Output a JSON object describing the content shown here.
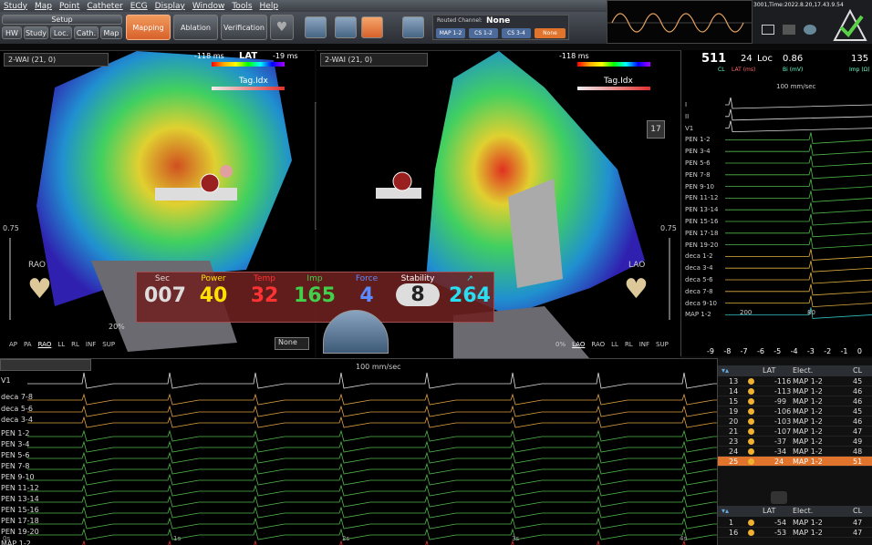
{
  "menu": [
    "Study",
    "Map",
    "Point",
    "Catheter",
    "ECG",
    "Display",
    "Window",
    "Tools",
    "Help"
  ],
  "toolbar": {
    "setup": "Setup",
    "sub": [
      "HW",
      "Study",
      "Loc.",
      "Cath.",
      "Map"
    ],
    "modes": [
      "Mapping",
      "Ablation",
      "Verification"
    ],
    "channel_label": "Routed Channel:",
    "channel_value": "None",
    "channels": [
      "MAP 1-2",
      "CS 1-2",
      "CS 3-4",
      "None"
    ]
  },
  "timestamp": "3001,Time:2022.8.20,17.43.9.54",
  "left_view": {
    "map": "2-WAI (21, 0)",
    "lat_min": "-118 ms",
    "lat_label": "LAT",
    "lat_max": "-19 ms",
    "tag": "Tag.Idx",
    "scale": "0.75",
    "view": "RAO",
    "zoom": "20%",
    "none": "None",
    "views": [
      "AP",
      "PA",
      "RAO",
      "LL",
      "RL",
      "INF",
      "SUP"
    ]
  },
  "right_view": {
    "map": "2-WAI (21, 0)",
    "lat_min": "-118 ms",
    "tag": "Tag.Idx",
    "scale": "0.75",
    "view": "LAO",
    "zoom": "0%",
    "views": [
      "0%",
      "LAO",
      "RAO",
      "LL",
      "RL",
      "INF",
      "SUP"
    ]
  },
  "center_tools": {
    "value": "4",
    "sub": "g"
  },
  "right_tools": {
    "num": "17"
  },
  "metrics": [
    {
      "label": "Sec",
      "value": "007",
      "color": "#ffffff"
    },
    {
      "label": "Power",
      "value": "40",
      "color": "#ffe000"
    },
    {
      "label": "Temp",
      "value": "32",
      "color": "#ff3333"
    },
    {
      "label": "Imp",
      "value": "165",
      "color": "#41d04a"
    },
    {
      "label": "Force",
      "value": "4",
      "color": "#5b8cff"
    },
    {
      "label": "Stability",
      "value": "8",
      "color": "#ffffff"
    },
    {
      "label": "↗",
      "value": "264",
      "color": "#27dff0"
    }
  ],
  "ecg_header": {
    "cl_value": "511",
    "cl_num": "24",
    "loc": "Loc",
    "loc_val": "0.86",
    "imp": "135",
    "cl_label": "CL",
    "lat_label": "LAT (ms)",
    "bi_label": "Bi (mV)",
    "imp_label": "Imp (Ω)",
    "speed": "100 mm/sec"
  },
  "ecg_leads": [
    "I",
    "II",
    "V1",
    "PEN 1-2",
    "PEN 3-4",
    "PEN 5-6",
    "PEN 7-8",
    "PEN 9-10",
    "PEN 11-12",
    "PEN 13-14",
    "PEN 15-16",
    "PEN 17-18",
    "PEN 19-20",
    "deca 1-2",
    "deca 3-4",
    "deca 5-6",
    "deca 7-8",
    "deca 9-10",
    "MAP 1-2"
  ],
  "ecg_scale": [
    "-9",
    "-8",
    "-7",
    "-6",
    "-5",
    "-4",
    "-3",
    "-2",
    "-1",
    "0"
  ],
  "ecg_marks": [
    "200",
    "80"
  ],
  "bottom": {
    "speed": "100 mm/sec",
    "leads": [
      "V1",
      "deca 7-8",
      "deca 5-6",
      "deca 3-4",
      "PEN 1-2",
      "PEN 3-4",
      "PEN 5-6",
      "PEN 7-8",
      "PEN 9-10",
      "PEN 11-12",
      "PEN 13-14",
      "PEN 15-16",
      "PEN 17-18",
      "PEN 19-20",
      "MAP 1-2"
    ],
    "times": [
      "0s",
      "1s",
      "2s",
      "3s",
      "4s"
    ]
  },
  "table": {
    "headers": [
      "",
      "LAT",
      "Elect.",
      "CL"
    ],
    "rows": [
      [
        "13",
        "-116",
        "MAP 1-2",
        "45"
      ],
      [
        "14",
        "-113",
        "MAP 1-2",
        "46"
      ],
      [
        "15",
        "-99",
        "MAP 1-2",
        "46"
      ],
      [
        "19",
        "-106",
        "MAP 1-2",
        "45"
      ],
      [
        "20",
        "-103",
        "MAP 1-2",
        "46"
      ],
      [
        "21",
        "-107",
        "MAP 1-2",
        "47"
      ],
      [
        "23",
        "-37",
        "MAP 1-2",
        "49"
      ],
      [
        "24",
        "-34",
        "MAP 1-2",
        "48"
      ],
      [
        "25",
        "24",
        "MAP 1-2",
        "51"
      ]
    ],
    "rows2": [
      [
        "1",
        "-54",
        "MAP 1-2",
        "47"
      ],
      [
        "16",
        "-53",
        "MAP 1-2",
        "47"
      ]
    ]
  },
  "colors": {
    "accent": "#e0742c",
    "panel": "#2b2e33"
  }
}
